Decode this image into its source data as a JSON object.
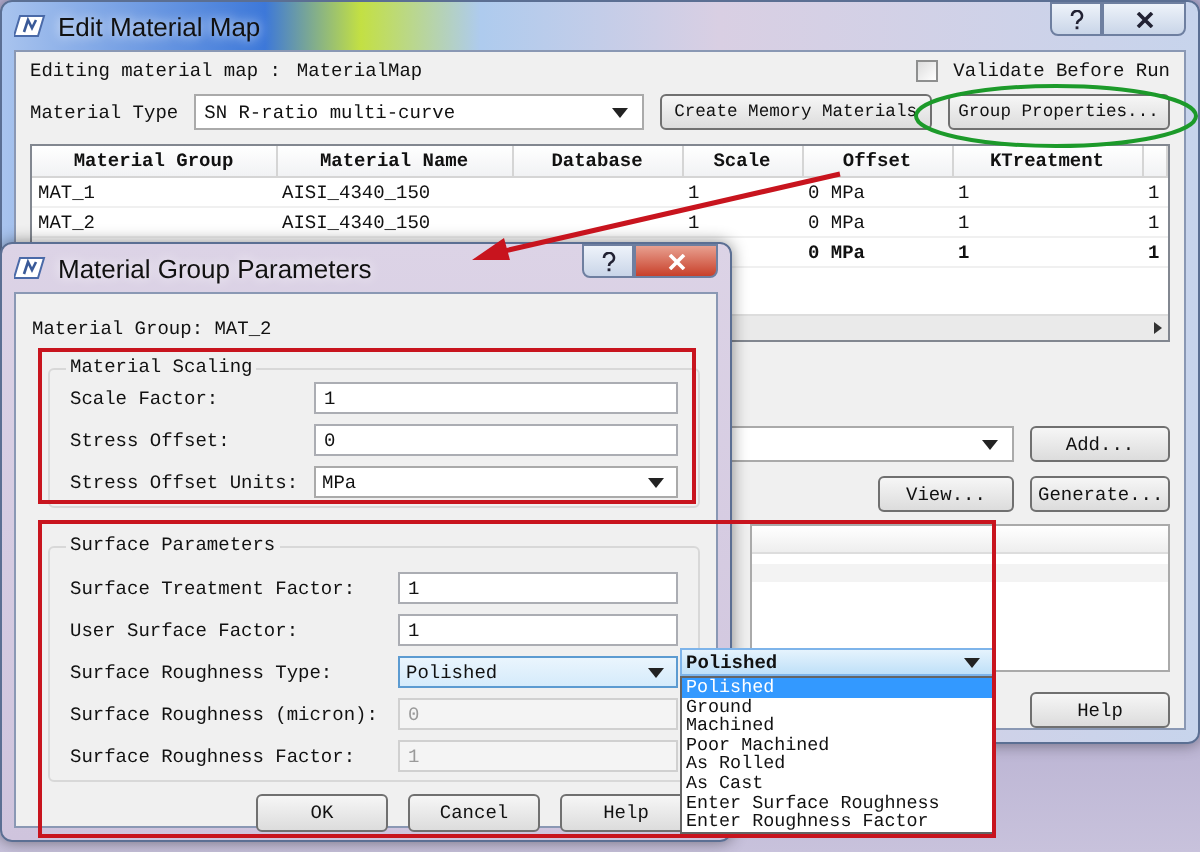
{
  "main_window": {
    "title": "Edit Material Map",
    "map_label": "Editing material map :",
    "map_name": "MaterialMap",
    "validate": {
      "label": "Validate Before Run",
      "checked": false
    },
    "material_type": {
      "label": "Material Type",
      "value": "SN R-ratio multi-curve"
    },
    "buttons": [
      "Create Memory Materials",
      "Group Properties..."
    ],
    "table": {
      "columns": [
        "Material Group",
        "Material Name",
        "Database",
        "Scale",
        "Offset",
        "KTreatment"
      ],
      "rows": [
        {
          "bold": false,
          "cells": [
            "MAT_1",
            "AISI_4340_150",
            null,
            "1",
            "0 MPa",
            "1",
            "1"
          ]
        },
        {
          "bold": false,
          "cells": [
            "MAT_2",
            "AISI_4340_150",
            null,
            "1",
            "0 MPa",
            "1",
            "1"
          ]
        },
        {
          "bold": true,
          "cells": [
            null,
            null,
            null,
            null,
            "0 MPa",
            "1",
            "1"
          ]
        }
      ]
    },
    "side_buttons": [
      "Add...",
      "View...",
      "Generate..."
    ],
    "help_button": "Help"
  },
  "dialog": {
    "title": "Material Group Parameters",
    "group_label": "Material Group: MAT_2",
    "groups": [
      {
        "title": "Material Scaling",
        "fields": [
          {
            "kind": "text",
            "label": "Scale Factor:",
            "value": "1",
            "disabled": false
          },
          {
            "kind": "text",
            "label": "Stress Offset:",
            "value": "0",
            "disabled": false
          },
          {
            "kind": "select",
            "label": "Stress Offset Units:",
            "value": "MPa"
          }
        ]
      },
      {
        "title": "Surface Parameters",
        "fields": [
          {
            "kind": "text",
            "label": "Surface Treatment Factor:",
            "value": "1",
            "disabled": false
          },
          {
            "kind": "text",
            "label": "User Surface Factor:",
            "value": "1",
            "disabled": false
          },
          {
            "kind": "select",
            "label": "Surface Roughness Type:",
            "value": "Polished"
          },
          {
            "kind": "text",
            "label": "Surface Roughness (micron):",
            "value": "0",
            "disabled": true
          },
          {
            "kind": "text",
            "label": "Surface Roughness Factor:",
            "value": "1",
            "disabled": true
          }
        ]
      }
    ],
    "buttons": [
      "OK",
      "Cancel",
      "Help"
    ]
  },
  "dropdown": {
    "value": "Polished",
    "options": [
      {
        "label": "Polished",
        "selected": true
      },
      {
        "label": "Ground",
        "selected": false
      },
      {
        "label": "Machined",
        "selected": false
      },
      {
        "label": "Poor Machined",
        "selected": false
      },
      {
        "label": "As Rolled",
        "selected": false
      },
      {
        "label": "As Cast",
        "selected": false
      },
      {
        "label": "Enter Surface Roughness",
        "selected": false
      },
      {
        "label": "Enter Roughness Factor",
        "selected": false
      }
    ]
  }
}
